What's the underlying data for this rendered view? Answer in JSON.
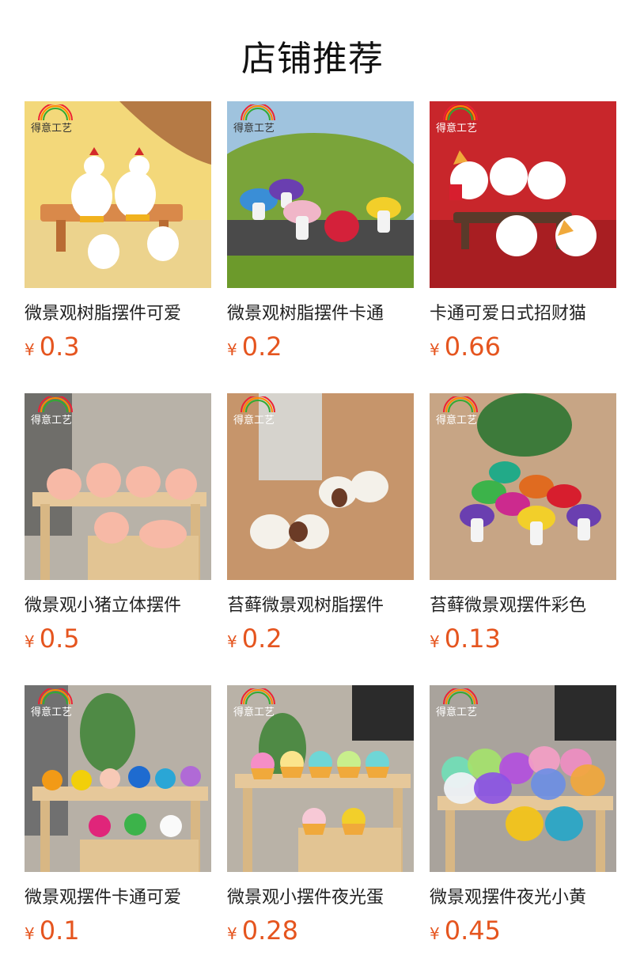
{
  "shop_title": "店铺推荐",
  "currency_symbol": "¥",
  "brand_logo_text": "得意工艺",
  "products": [
    {
      "name": "微景观树脂摆件可爱",
      "price": "0.3"
    },
    {
      "name": "微景观树脂摆件卡通",
      "price": "0.2"
    },
    {
      "name": "卡通可爱日式招财猫",
      "price": "0.66"
    },
    {
      "name": "微景观小猪立体摆件",
      "price": "0.5"
    },
    {
      "name": "苔藓微景观树脂摆件",
      "price": "0.2"
    },
    {
      "name": "苔藓微景观摆件彩色",
      "price": "0.13"
    },
    {
      "name": "微景观摆件卡通可爱",
      "price": "0.1"
    },
    {
      "name": "微景观小摆件夜光蛋",
      "price": "0.28"
    },
    {
      "name": "微景观摆件夜光小黄",
      "price": "0.45"
    }
  ]
}
